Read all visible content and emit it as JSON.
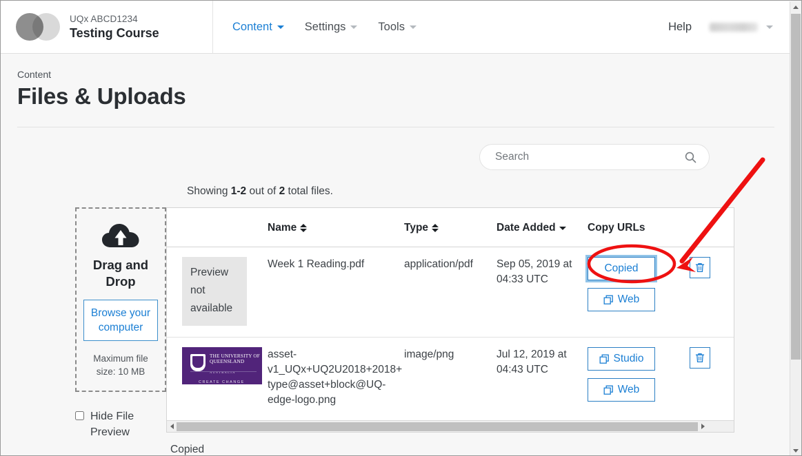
{
  "header": {
    "course_code": "UQx ABCD1234",
    "course_name": "Testing Course",
    "logo_icon": "course-logo-placeholder-icon",
    "nav": [
      {
        "label": "Content",
        "icon": "chevron-down-icon",
        "active": true
      },
      {
        "label": "Settings",
        "icon": "chevron-down-icon",
        "active": false
      },
      {
        "label": "Tools",
        "icon": "chevron-down-icon",
        "active": false
      }
    ],
    "help_label": "Help",
    "account_name": "",
    "account_icon": "chevron-down-icon"
  },
  "page": {
    "breadcrumb": "Content",
    "title": "Files & Uploads"
  },
  "search": {
    "placeholder": "Search",
    "value": "",
    "icon": "search-icon"
  },
  "showing": {
    "prefix": "Showing ",
    "range": "1-2",
    "middle": " out of ",
    "total": "2",
    "suffix": " total files."
  },
  "dropzone": {
    "icon": "cloud-upload-icon",
    "title": "Drag and Drop",
    "browse_label": "Browse your computer",
    "max_size": "Maximum file size: 10 MB"
  },
  "hide_preview": {
    "label": "Hide File Preview",
    "checked": false
  },
  "table": {
    "columns": [
      {
        "key": "thumb",
        "label": "",
        "sort": "none"
      },
      {
        "key": "name",
        "label": "Name",
        "sort": "both"
      },
      {
        "key": "type",
        "label": "Type",
        "sort": "both"
      },
      {
        "key": "date",
        "label": "Date Added",
        "sort": "desc"
      },
      {
        "key": "urls",
        "label": "Copy URLs",
        "sort": "none"
      },
      {
        "key": "del",
        "label": "",
        "sort": "none"
      }
    ],
    "rows": [
      {
        "thumb_type": "text",
        "thumb_text": "Preview not available",
        "name": "Week 1 Reading.pdf",
        "type": "application/pdf",
        "date": "Sep 05, 2019 at 04:33 UTC",
        "buttons": [
          {
            "label": "Copied",
            "icon": "none",
            "focused": true
          },
          {
            "label": "Web",
            "icon": "copy-icon",
            "focused": false
          }
        ],
        "delete_icon": "trash-icon"
      },
      {
        "thumb_type": "image",
        "thumb_alt": "uq-logo-thumbnail",
        "thumb_logo": {
          "line1": "THE UNIVERSITY OF QUEENSLAND",
          "line2": "AUSTRALIA",
          "tagline": "CREATE CHANGE",
          "color": "#51247a"
        },
        "name": "asset-v1_UQx+UQ2U2018+2018+type@asset+block@UQ-edge-logo.png",
        "type": "image/png",
        "date": "Jul 12, 2019 at 04:43 UTC",
        "buttons": [
          {
            "label": "Studio",
            "icon": "copy-icon",
            "focused": false
          },
          {
            "label": "Web",
            "icon": "copy-icon",
            "focused": false
          }
        ],
        "delete_icon": "trash-icon"
      }
    ]
  },
  "status": {
    "text": "Copied"
  },
  "scrollbars": {
    "vertical_up_icon": "scroll-up-icon",
    "vertical_down_icon": "scroll-down-icon",
    "horizontal_left_icon": "scroll-left-icon",
    "horizontal_right_icon": "scroll-right-icon"
  },
  "annotations": {
    "arrow_color": "#ee1111",
    "ellipse_color": "#ee1111",
    "arrow_target": "copied-button",
    "ellipse_target": "copied-button"
  },
  "colors": {
    "link_blue": "#1b7fd4",
    "button_border": "#2b7fc4",
    "focus_ring": "#92c4e8",
    "brand_purple": "#51247a",
    "annotation_red": "#ee1111",
    "page_bg": "#f7f7f7"
  }
}
